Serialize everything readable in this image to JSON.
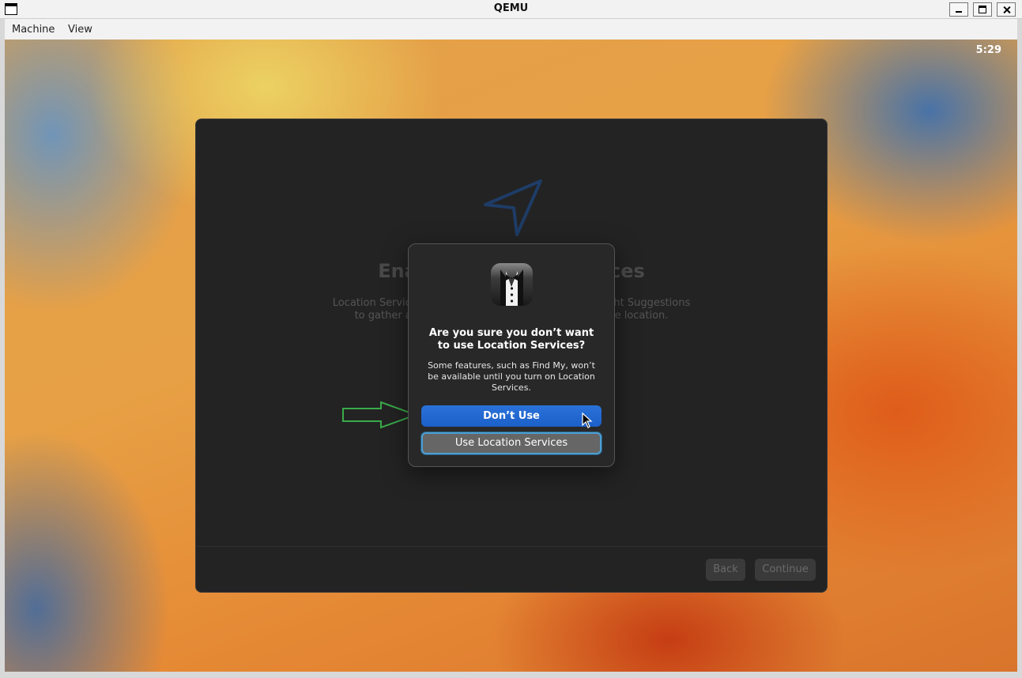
{
  "window": {
    "title": "QEMU"
  },
  "menu": {
    "items": [
      "Machine",
      "View"
    ]
  },
  "status": {
    "clock": "5:29"
  },
  "setup": {
    "heading": "Enable Location Services",
    "body": "Location Services allows apps and services like Spotlight Suggestions to gather and use data indicating your approximate location.",
    "back_label": "Back",
    "continue_label": "Continue"
  },
  "dialog": {
    "title": "Are you sure you don’t want to use Location Services?",
    "message": "Some features, such as Find My, won’t be available until you turn on Location Services.",
    "primary_label": "Don’t Use",
    "secondary_label": "Use Location Services"
  },
  "colors": {
    "accent": "#1c5fc8",
    "focus_ring": "#4c9fd3",
    "annotation_arrow": "#3aaa4a"
  }
}
